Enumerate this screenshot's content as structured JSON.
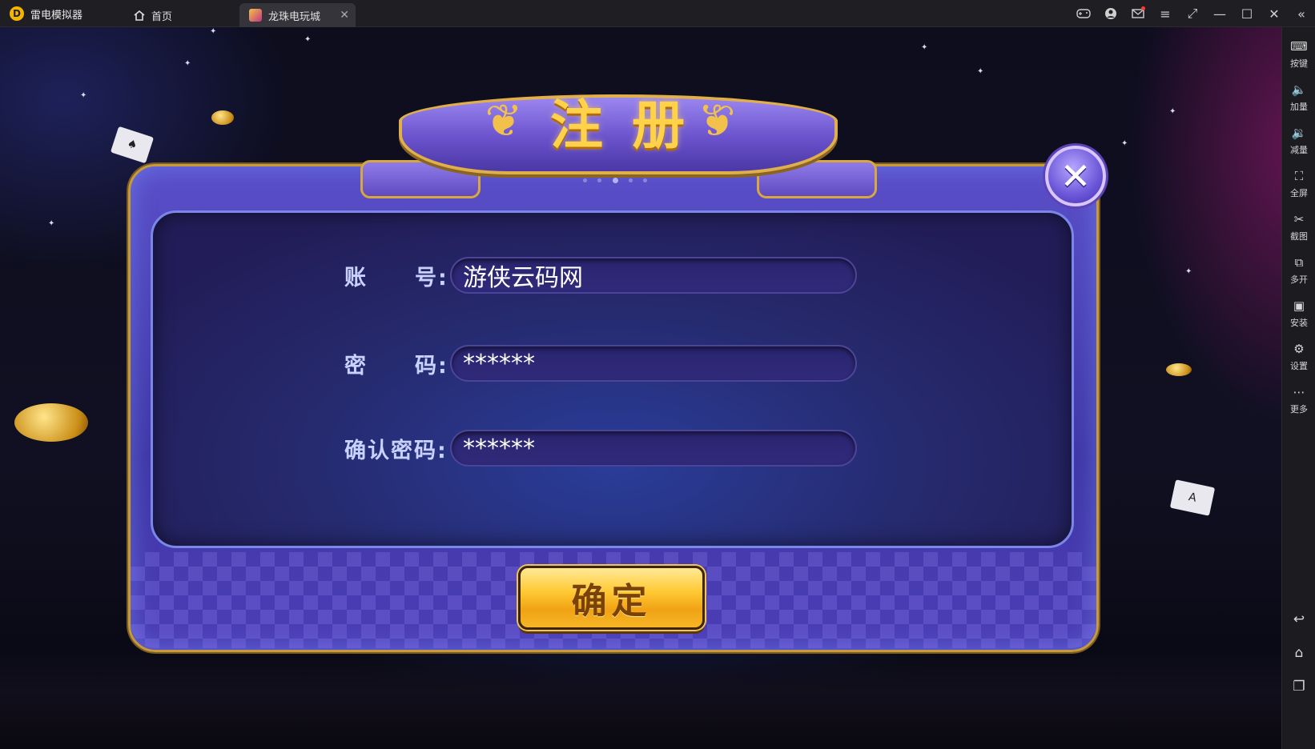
{
  "titlebar": {
    "app_name": "雷电模拟器",
    "logo_letter": "D",
    "tabs": [
      {
        "label": "首页",
        "icon": "home-icon"
      },
      {
        "label": "龙珠电玩城",
        "icon": "game-icon",
        "close": "✕"
      }
    ],
    "controls": [
      "gamepad-icon",
      "user-icon",
      "mail-icon",
      "menu-icon",
      "resize-icon",
      "minimize-icon",
      "maximize-icon",
      "close-icon",
      "collapse-icon"
    ]
  },
  "sidebar": {
    "items": [
      {
        "label": "按键",
        "icon": "keyboard-icon"
      },
      {
        "label": "加量",
        "icon": "volume-up-icon"
      },
      {
        "label": "减量",
        "icon": "volume-down-icon"
      },
      {
        "label": "全屏",
        "icon": "fullscreen-icon"
      },
      {
        "label": "截图",
        "icon": "scissors-icon"
      },
      {
        "label": "多开",
        "icon": "multi-instance-icon"
      },
      {
        "label": "安装",
        "icon": "apk-install-icon"
      },
      {
        "label": "设置",
        "icon": "settings-icon"
      },
      {
        "label": "更多",
        "icon": "more-icon"
      }
    ],
    "nav": [
      "back-icon",
      "home-icon",
      "recent-apps-icon"
    ]
  },
  "dialog": {
    "title_chars": [
      "注",
      "册"
    ],
    "fields": [
      {
        "label_left": "账",
        "label_right": "号",
        "colon": ":",
        "value": "游侠云码网"
      },
      {
        "label_left": "密",
        "label_right": "码",
        "colon": ":",
        "value": "******"
      },
      {
        "label_full": "确认密码",
        "colon": ":",
        "value": "******"
      }
    ],
    "confirm_label": "确定",
    "close_glyph": "✕"
  },
  "colors": {
    "accent_gold": "#ffd24a",
    "dialog_purple": "#4c3eb6",
    "titlebar_bg": "#1f1f23"
  }
}
